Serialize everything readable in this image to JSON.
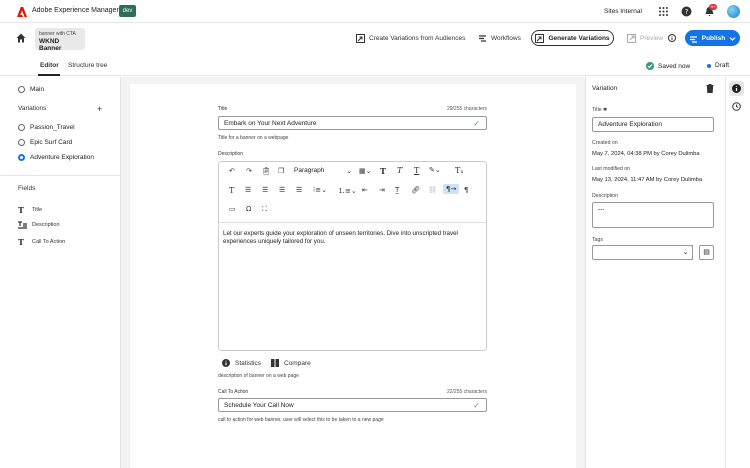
{
  "topbar": {
    "app_name": "Adobe Experience Manager",
    "env_badge": "dev",
    "org": "Sites Internal",
    "notif_count": "9+"
  },
  "header": {
    "crumb_sub": "banner with CTA",
    "crumb_title": "WKND Banner",
    "create_variations": "Create Variations from Audiences",
    "workflows": "Workflows",
    "generate": "Generate Variations",
    "preview": "Preview",
    "publish": "Publish"
  },
  "tabs": {
    "editor": "Editor",
    "structure": "Structure tree"
  },
  "status": {
    "saved": "Saved now",
    "draft": "Draft"
  },
  "left": {
    "main": "Main",
    "variations_title": "Variations",
    "variations": [
      "Passion_Travel",
      "Epic Surf Card",
      "Adventure Exploration"
    ],
    "selected_index": 2,
    "fields_title": "Fields",
    "fields": [
      "Title",
      "Description",
      "Call To Action"
    ]
  },
  "form": {
    "title_label": "Title",
    "title_count": "29/255 characters",
    "title_value": "Embark on Your Next Adventure",
    "title_help": "Title for a banner on a webpage",
    "desc_label": "Description",
    "paragraph": "Paragraph",
    "desc_text": "Let our experts guide your exploration of unseen territories. Dive into unscripted travel experiences uniquely tailored for you.",
    "statistics": "Statistics",
    "compare": "Compare",
    "desc_help": "description of banner on a web page",
    "cta_label": "Call To Action",
    "cta_count": "22/255 characters",
    "cta_value": "Schedule Your Call Now",
    "cta_help": "call to action for web banner. user will select this to be taken to a new page"
  },
  "right": {
    "title": "Variation",
    "title_label": "Title ✱",
    "title_value": "Adventure Exploration",
    "created_label": "Created on",
    "created_value": "May 7, 2024, 04:38 PM by Corey Dulimba",
    "modified_label": "Last modified on",
    "modified_value": "May 13, 2024, 11:47 AM by Corey Dulimba",
    "desc_label": "Description",
    "desc_value": "---",
    "tags_label": "Tags"
  },
  "colors": {
    "accent": "#1473e6",
    "success": "#2d9d78",
    "badge": "#2d6e5a"
  }
}
